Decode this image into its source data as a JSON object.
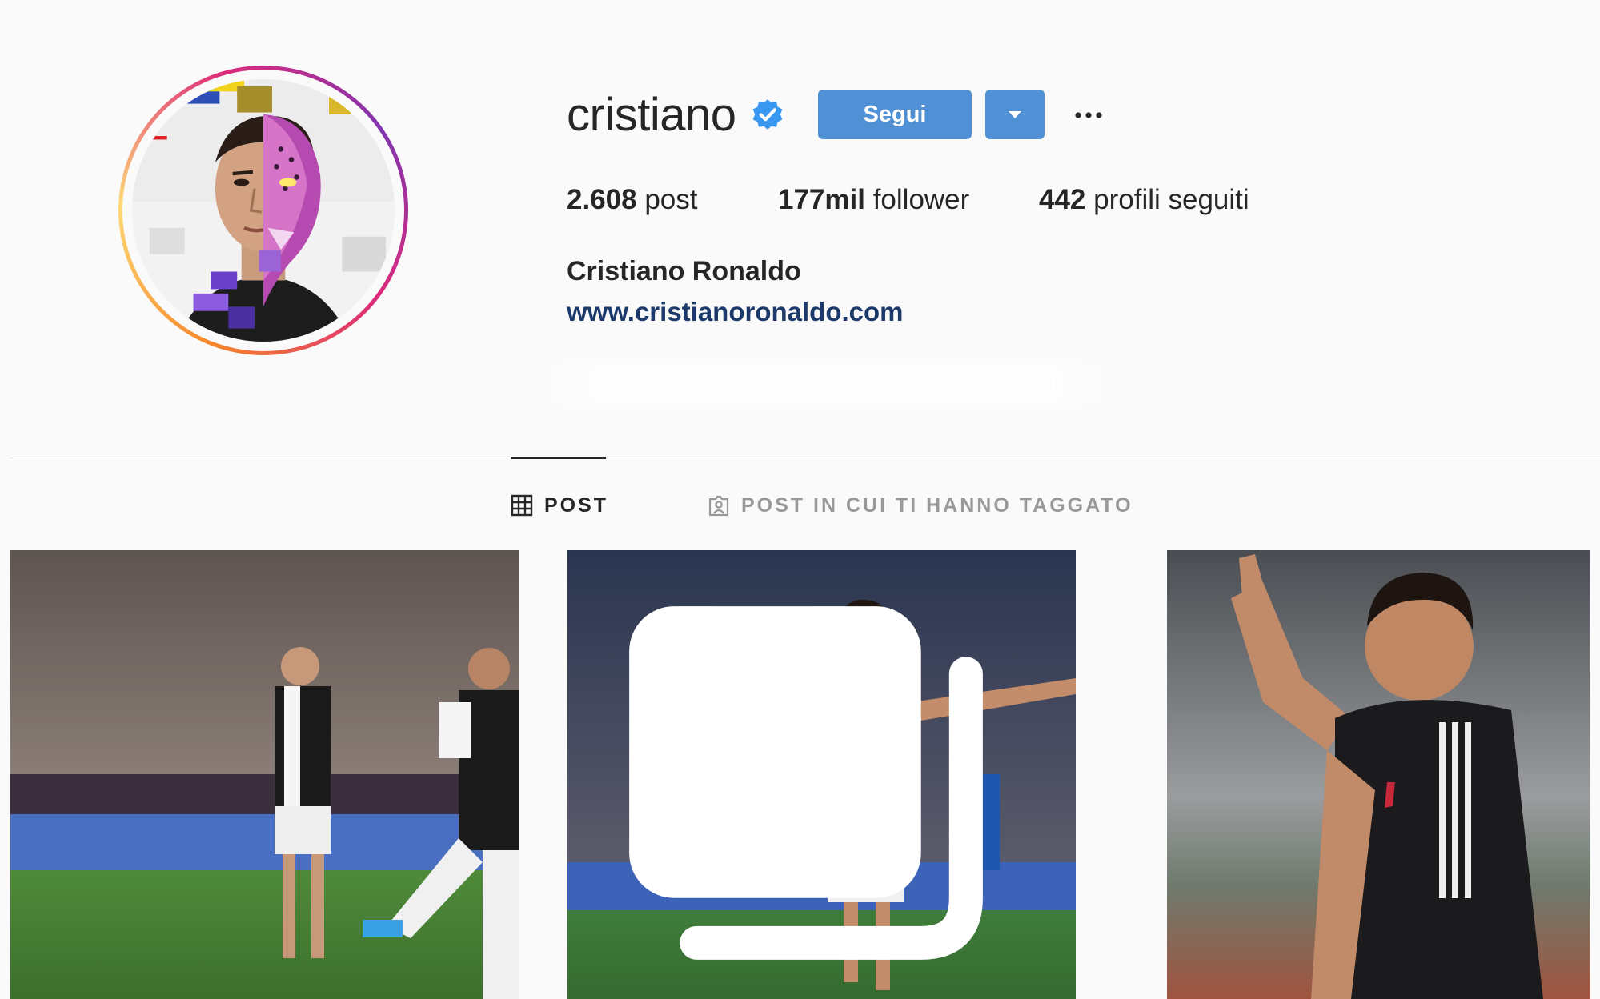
{
  "profile": {
    "username": "cristiano",
    "follow_label": "Segui",
    "full_name": "Cristiano Ronaldo",
    "website": "www.cristianoronaldo.com"
  },
  "stats": {
    "posts_value": "2.608",
    "posts_label": "post",
    "followers_value": "177mil",
    "followers_label": "follower",
    "following_value": "442",
    "following_label": "profili seguiti"
  },
  "tabs": {
    "posts_label": "POST",
    "tagged_label": "POST IN CUI TI HANNO TAGGATO"
  },
  "colors": {
    "follow_button": "#4f91d4",
    "website_link": "#1b3a6b",
    "story_ring": [
      "#f58529",
      "#dd2a7b",
      "#8134af"
    ]
  },
  "icons": {
    "verified": "verified-badge-icon",
    "dropdown": "chevron-down-icon",
    "more": "more-options-icon",
    "posts_tab": "grid-icon",
    "tagged_tab": "tagged-person-icon",
    "carousel": "carousel-icon"
  }
}
